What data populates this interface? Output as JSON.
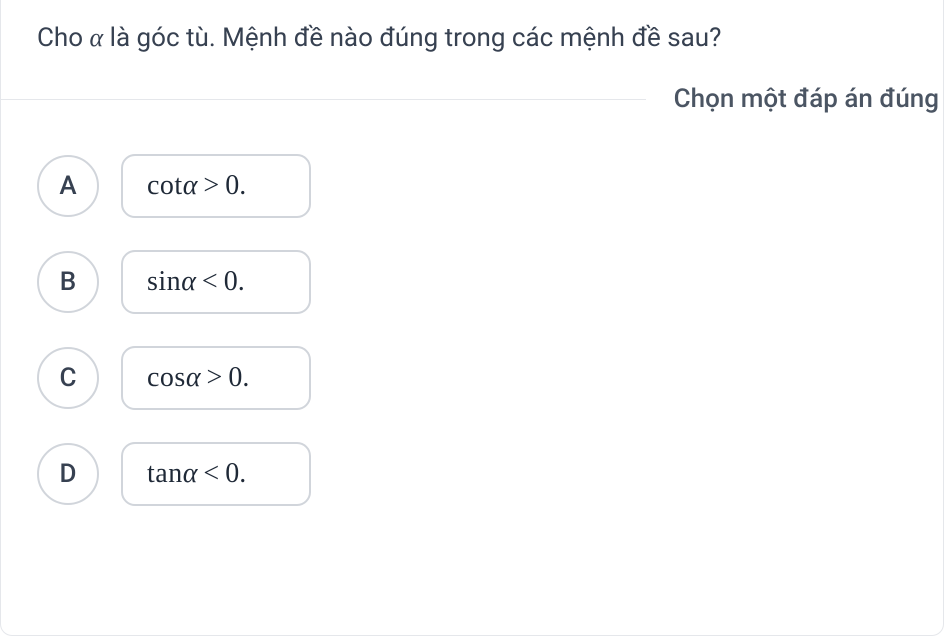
{
  "question": {
    "prefix": "Cho ",
    "var": "α",
    "suffix": " là góc tù. Mệnh đề nào đúng trong các mệnh đề sau?"
  },
  "instruction": "Chọn một đáp án đúng",
  "options": [
    {
      "letter": "A",
      "func": "cot",
      "var": "α",
      "op": ">",
      "rhs": "0",
      "tail": " ."
    },
    {
      "letter": "B",
      "func": "sin",
      "var": "α",
      "op": "<",
      "rhs": "0",
      "tail": " ."
    },
    {
      "letter": "C",
      "func": "cos",
      "var": "α",
      "op": ">",
      "rhs": "0",
      "tail": " ."
    },
    {
      "letter": "D",
      "func": "tan",
      "var": "α",
      "op": "<",
      "rhs": "0",
      "tail": " ."
    }
  ]
}
